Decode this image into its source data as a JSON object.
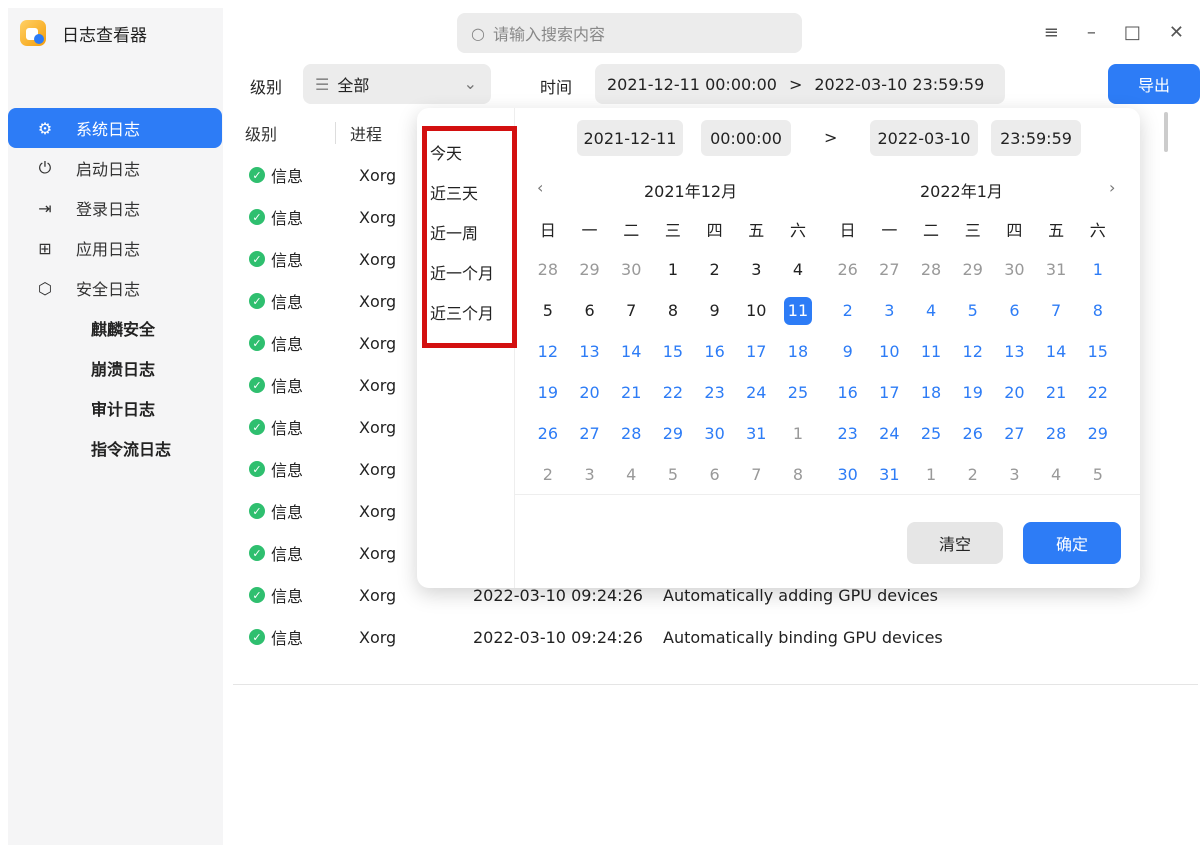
{
  "app": {
    "title": "日志查看器",
    "icon": "log-viewer-app-icon"
  },
  "search": {
    "placeholder": "请输入搜索内容"
  },
  "window_controls": [
    "menu",
    "minimize",
    "maximize",
    "close"
  ],
  "sidebar": {
    "items": [
      {
        "label": "系统日志",
        "icon": "gear-icon",
        "active": true
      },
      {
        "label": "启动日志",
        "icon": "power-icon",
        "active": false
      },
      {
        "label": "登录日志",
        "icon": "login-icon",
        "active": false
      },
      {
        "label": "应用日志",
        "icon": "apps-grid-icon",
        "active": false
      },
      {
        "label": "安全日志",
        "icon": "shield-icon",
        "active": false
      }
    ],
    "sub_items": [
      "麒麟安全",
      "崩溃日志",
      "审计日志",
      "指令流日志"
    ]
  },
  "toolbar": {
    "level_label": "级别",
    "level_value": "全部",
    "time_label": "时间",
    "time_start": "2021-12-11 00:00:00",
    "time_arrow": ">",
    "time_end": "2022-03-10 23:59:59",
    "export_label": "导出"
  },
  "table": {
    "headers": [
      "级别",
      "进程"
    ],
    "rows": [
      {
        "level": "信息",
        "process": "Xorg",
        "time": "",
        "message": ""
      },
      {
        "level": "信息",
        "process": "Xorg",
        "time": "",
        "message": ""
      },
      {
        "level": "信息",
        "process": "Xorg",
        "time": "",
        "message": ""
      },
      {
        "level": "信息",
        "process": "Xorg",
        "time": "",
        "message": ""
      },
      {
        "level": "信息",
        "process": "Xorg",
        "time": "",
        "message": ""
      },
      {
        "level": "信息",
        "process": "Xorg",
        "time": "",
        "message": ""
      },
      {
        "level": "信息",
        "process": "Xorg",
        "time": "",
        "message": ""
      },
      {
        "level": "信息",
        "process": "Xorg",
        "time": "",
        "message": ""
      },
      {
        "level": "信息",
        "process": "Xorg",
        "time": "",
        "message": ""
      },
      {
        "level": "信息",
        "process": "Xorg",
        "time": "",
        "message": ""
      },
      {
        "level": "信息",
        "process": "Xorg",
        "time": "2022-03-10 09:24:26",
        "message": "Automatically adding GPU devices"
      },
      {
        "level": "信息",
        "process": "Xorg",
        "time": "2022-03-10 09:24:26",
        "message": "Automatically binding GPU devices"
      }
    ]
  },
  "picker": {
    "shortcuts": [
      "今天",
      "近三天",
      "近一周",
      "近一个月",
      "近三个月"
    ],
    "start_date": "2021-12-11",
    "start_time": "00:00:00",
    "end_date": "2022-03-10",
    "end_time": "23:59:59",
    "arrow": ">",
    "prev": "‹",
    "next": "›",
    "left_month": "2021年12月",
    "right_month": "2022年1月",
    "weekdays": [
      "日",
      "一",
      "二",
      "三",
      "四",
      "五",
      "六"
    ],
    "left_days": [
      [
        "28",
        "m"
      ],
      [
        "29",
        "m"
      ],
      [
        "30",
        "m"
      ],
      [
        "1",
        "d"
      ],
      [
        "2",
        "d"
      ],
      [
        "3",
        "d"
      ],
      [
        "4",
        "d"
      ],
      [
        "5",
        "d"
      ],
      [
        "6",
        "d"
      ],
      [
        "7",
        "d"
      ],
      [
        "8",
        "d"
      ],
      [
        "9",
        "d"
      ],
      [
        "10",
        "d"
      ],
      [
        "11",
        "s"
      ],
      [
        "12",
        "b"
      ],
      [
        "13",
        "b"
      ],
      [
        "14",
        "b"
      ],
      [
        "15",
        "b"
      ],
      [
        "16",
        "b"
      ],
      [
        "17",
        "b"
      ],
      [
        "18",
        "b"
      ],
      [
        "19",
        "b"
      ],
      [
        "20",
        "b"
      ],
      [
        "21",
        "b"
      ],
      [
        "22",
        "b"
      ],
      [
        "23",
        "b"
      ],
      [
        "24",
        "b"
      ],
      [
        "25",
        "b"
      ],
      [
        "26",
        "b"
      ],
      [
        "27",
        "b"
      ],
      [
        "28",
        "b"
      ],
      [
        "29",
        "b"
      ],
      [
        "30",
        "b"
      ],
      [
        "31",
        "b"
      ],
      [
        "1",
        "m"
      ],
      [
        "2",
        "m"
      ],
      [
        "3",
        "m"
      ],
      [
        "4",
        "m"
      ],
      [
        "5",
        "m"
      ],
      [
        "6",
        "m"
      ],
      [
        "7",
        "m"
      ],
      [
        "8",
        "m"
      ]
    ],
    "right_days": [
      [
        "26",
        "m"
      ],
      [
        "27",
        "m"
      ],
      [
        "28",
        "m"
      ],
      [
        "29",
        "m"
      ],
      [
        "30",
        "m"
      ],
      [
        "31",
        "m"
      ],
      [
        "1",
        "b"
      ],
      [
        "2",
        "b"
      ],
      [
        "3",
        "b"
      ],
      [
        "4",
        "b"
      ],
      [
        "5",
        "b"
      ],
      [
        "6",
        "b"
      ],
      [
        "7",
        "b"
      ],
      [
        "8",
        "b"
      ],
      [
        "9",
        "b"
      ],
      [
        "10",
        "b"
      ],
      [
        "11",
        "b"
      ],
      [
        "12",
        "b"
      ],
      [
        "13",
        "b"
      ],
      [
        "14",
        "b"
      ],
      [
        "15",
        "b"
      ],
      [
        "16",
        "b"
      ],
      [
        "17",
        "b"
      ],
      [
        "18",
        "b"
      ],
      [
        "19",
        "b"
      ],
      [
        "20",
        "b"
      ],
      [
        "21",
        "b"
      ],
      [
        "22",
        "b"
      ],
      [
        "23",
        "b"
      ],
      [
        "24",
        "b"
      ],
      [
        "25",
        "b"
      ],
      [
        "26",
        "b"
      ],
      [
        "27",
        "b"
      ],
      [
        "28",
        "b"
      ],
      [
        "29",
        "b"
      ],
      [
        "30",
        "b"
      ],
      [
        "31",
        "b"
      ],
      [
        "1",
        "m"
      ],
      [
        "2",
        "m"
      ],
      [
        "3",
        "m"
      ],
      [
        "4",
        "m"
      ],
      [
        "5",
        "m"
      ]
    ],
    "clear_label": "清空",
    "ok_label": "确定"
  },
  "colors": {
    "accent": "#2d7cf6",
    "highlight_box": "#d31010",
    "info_check": "#2fbf6f"
  }
}
